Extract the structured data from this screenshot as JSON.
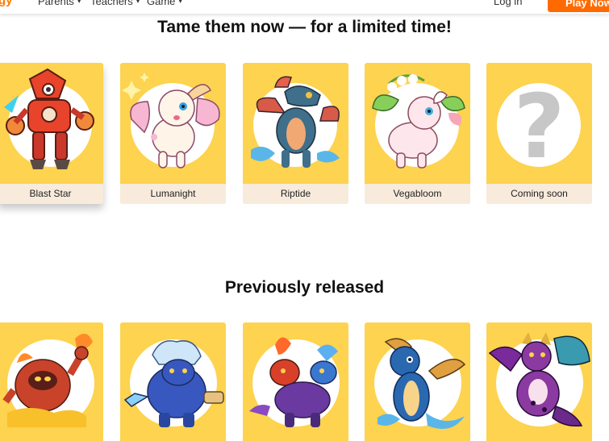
{
  "header": {
    "brand": "gy",
    "nav": [
      {
        "label": "Parents"
      },
      {
        "label": "Teachers"
      },
      {
        "label": "Game"
      }
    ],
    "login": "Log in",
    "play": "Play Now"
  },
  "limited": {
    "title": "Tame them now — for a limited time!",
    "cards": [
      {
        "name": "Blast Star",
        "icon": "blast-star-icon"
      },
      {
        "name": "Lumanight",
        "icon": "lumanight-icon"
      },
      {
        "name": "Riptide",
        "icon": "riptide-icon"
      },
      {
        "name": "Vegabloom",
        "icon": "vegabloom-icon"
      },
      {
        "name": "Coming soon",
        "icon": "question-mark-icon"
      }
    ]
  },
  "previous": {
    "title": "Previously released",
    "cards": [
      {
        "icon": "fire-creature-icon"
      },
      {
        "icon": "ice-beast-icon"
      },
      {
        "icon": "fire-ice-dragon-icon"
      },
      {
        "icon": "water-serpent-icon"
      },
      {
        "icon": "winged-dragon-icon"
      }
    ]
  },
  "colors": {
    "card_bg": "#fdd34f",
    "label_bg": "#f8ebdc",
    "accent": "#ff6a00"
  }
}
